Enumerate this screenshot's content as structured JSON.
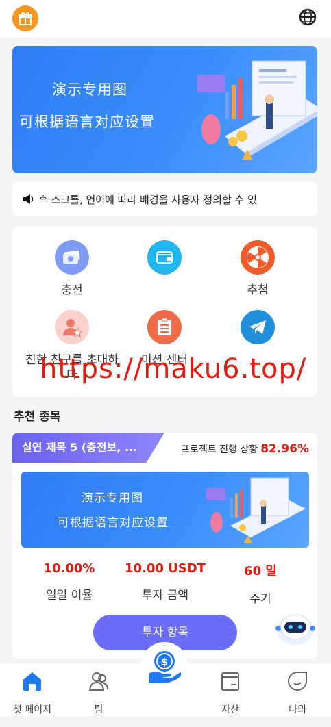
{
  "header": {
    "gift_icon": "gift-icon",
    "language_icon": "globe-icon"
  },
  "banner": {
    "line1": "演示专用图",
    "line2": "可根据语言对应设置"
  },
  "notice": {
    "icon": "speaker-icon",
    "text": "ᄒ 스크롤, 언어에 따라 배경을 사용자 정의할 수 있"
  },
  "menu": [
    {
      "label": "충전",
      "icon": "money-icon",
      "color": "#7f9cf5"
    },
    {
      "label": "",
      "icon": "wallet-icon",
      "color": "#22b6ef"
    },
    {
      "label": "추첨",
      "icon": "wheel-icon",
      "color": "#f25c2c"
    },
    {
      "label": "친한 친구를 초대하다",
      "icon": "invite-user-icon",
      "color": "#fbd2cb"
    },
    {
      "label": "미션 센터",
      "icon": "task-list-icon",
      "color": "#f06b48"
    },
    {
      "label": "",
      "icon": "telegram-icon",
      "color": "#1e8fd8"
    }
  ],
  "watermark": "https://maku6.top/",
  "section": {
    "title": "추천 종목"
  },
  "product": {
    "name": "실연 제목 5 (충전보, ...",
    "progress_label": "프로젝트 진행 상황",
    "progress_value": "82.96%",
    "banner_line1": "演示专用图",
    "banner_line2": "可根据语言对应设置",
    "stats": [
      {
        "value": "10.00%",
        "label": "일일 이율"
      },
      {
        "value": "10.00 USDT",
        "label": "투자 금액"
      },
      {
        "value": "60 일",
        "label": "주기"
      }
    ],
    "button": "투자 항목"
  },
  "tabbar": [
    {
      "label": "첫 페이지",
      "icon": "home-icon",
      "active": true
    },
    {
      "label": "팀",
      "icon": "team-icon",
      "active": false
    },
    {
      "label": "",
      "icon": "invest-coin-icon",
      "active": false
    },
    {
      "label": "자산",
      "icon": "wallet-icon",
      "active": false
    },
    {
      "label": "나의",
      "icon": "profile-icon",
      "active": false
    }
  ],
  "colors": {
    "accent": "#6b6cf7",
    "red": "#e8190d",
    "blue": "#1e7af0"
  }
}
